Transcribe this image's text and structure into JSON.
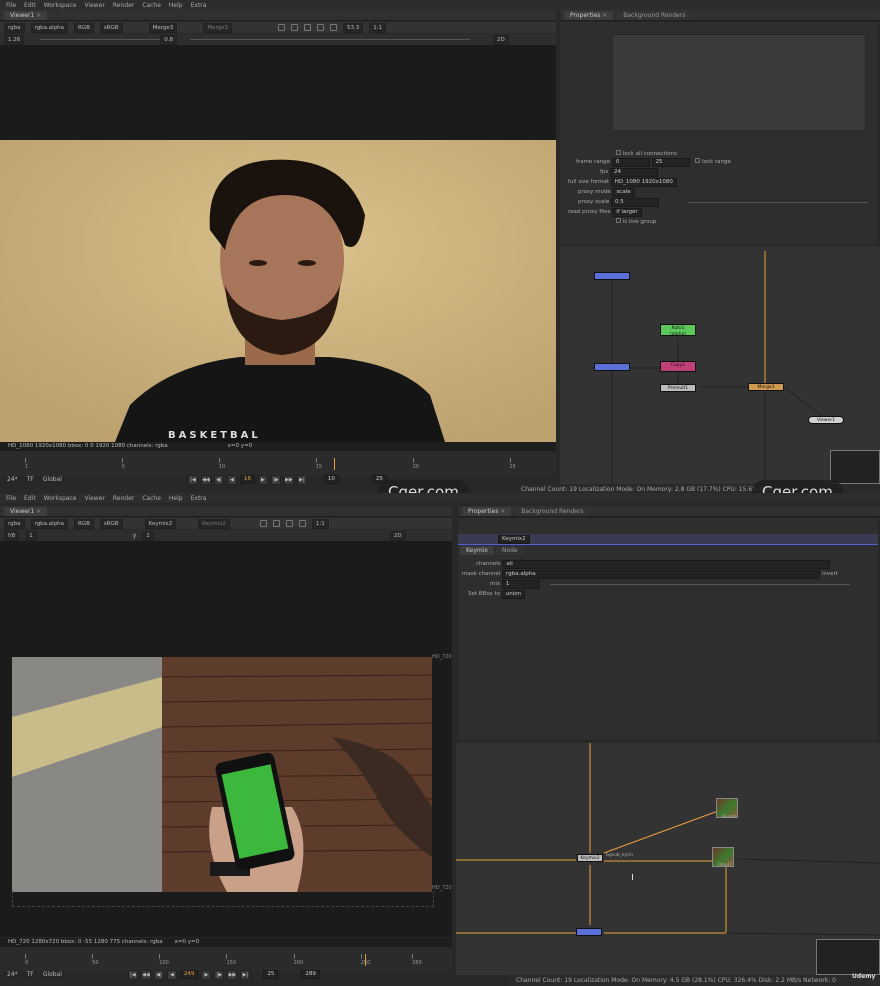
{
  "menu": [
    "File",
    "Edit",
    "Workspace",
    "Viewer",
    "Render",
    "Cache",
    "Help",
    "Extra"
  ],
  "top": {
    "viewer_tab": "Viewer1",
    "channel_select": "rgba",
    "alpha_select": "rgba.alpha",
    "color_select": "RGB",
    "colorspace_select": "sRGB",
    "input_a": "Merge3",
    "input_b": "Merge3",
    "zoom": "53.3",
    "ratio": "1:1",
    "view_mode": "2D",
    "gain": "1.26",
    "gamma": "0.8",
    "info": "HD_1080 1920x1080  bbox: 0 0 1920 1080 channels: rgba",
    "coords": "x=0 y=0",
    "fps": "24*",
    "tf": "TF",
    "global": "Global",
    "frame": "16",
    "step": "10",
    "end_frame": "25",
    "timeline_labels": [
      "1",
      "5",
      "10",
      "15",
      "20",
      "25"
    ],
    "shirt_text": "BASKETBAL",
    "panel_tabs": [
      "Properties",
      "Background Renders"
    ],
    "props": {
      "lock_all": "lock all connections",
      "frame_range_label": "frame range",
      "frame_start": "0",
      "frame_end": "25",
      "lock_range": "lock range",
      "fps_label": "fps",
      "fps_value": "24",
      "format_label": "full size format",
      "format_value": "HD_1080 1920x1080",
      "proxy_mode_label": "proxy mode",
      "proxy_mode_value": "scale",
      "proxy_scale_label": "proxy scale",
      "proxy_scale_value": "0.5",
      "read_proxy_label": "read proxy files",
      "read_proxy_value": "if larger",
      "live_group": "is live group"
    },
    "nodes": {
      "roto": "Roto1",
      "roto_sub": "(alpha)",
      "copy": "Copy1",
      "premult": "Premult1",
      "viewer": "Viewer1",
      "merge": "Merge3"
    },
    "status": "Channel Count: 19 Localization Mode: On Memory: 2.8 GB (17.7%) CPU: 15.6% Disk:",
    "watermark": "Cger.com"
  },
  "bottom": {
    "viewer_tab": "Viewer1",
    "channel_select": "rgba",
    "alpha_select": "rgba.alpha",
    "color_select": "RGB",
    "colorspace_select": "sRGB",
    "input_a": "Keymix2",
    "input_b": "Keymix2",
    "ratio": "1:1",
    "view_mode": "2D",
    "frame_field": "1",
    "y_label": "y",
    "y_value": "1",
    "fstop": "f/8",
    "format_tag": "HD_720",
    "format_tag2": "HD_720",
    "info": "HD_720 1280x720  bbox: 0 -55 1280 775 channels: rgba",
    "coords": "x=0 y=0",
    "fps": "24*",
    "tf": "TF",
    "global": "Global",
    "frame": "249",
    "step": "25",
    "end_frame": "289",
    "timeline_labels": [
      "0",
      "50",
      "100",
      "150",
      "200",
      "250",
      "289"
    ],
    "panel_tabs": [
      "Properties",
      "Background Renders"
    ],
    "node_name": "Keymix2",
    "sub_tabs": [
      "Keymix",
      "Node"
    ],
    "props": {
      "channels_label": "channels",
      "channels_value": "all",
      "mask_label": "mask channel",
      "mask_value": "rgba.alpha",
      "invert": "invert",
      "mix_label": "mix",
      "mix_value": "1",
      "bbox_label": "Set BBox to",
      "bbox_value": "union"
    },
    "nodes": {
      "read1": "Read6",
      "read2": "Read7",
      "keymix": "Keymix2",
      "keymix_sub": "bgsub_kyrin"
    },
    "status": "Channel Count: 19 Localization Mode: On Memory: 4.5 GB (28.1%) CPU: 326.4% Disk: 2.2 MB/s Network: 0",
    "udemy": "Udemy"
  },
  "colors": {
    "accent_orange": "#e8a03a",
    "node_blue": "#5a6fd8",
    "node_green": "#5cc85c",
    "node_pink": "#c0407a",
    "node_grey": "#bcbcbc",
    "greenscreen": "#3cb83c"
  }
}
